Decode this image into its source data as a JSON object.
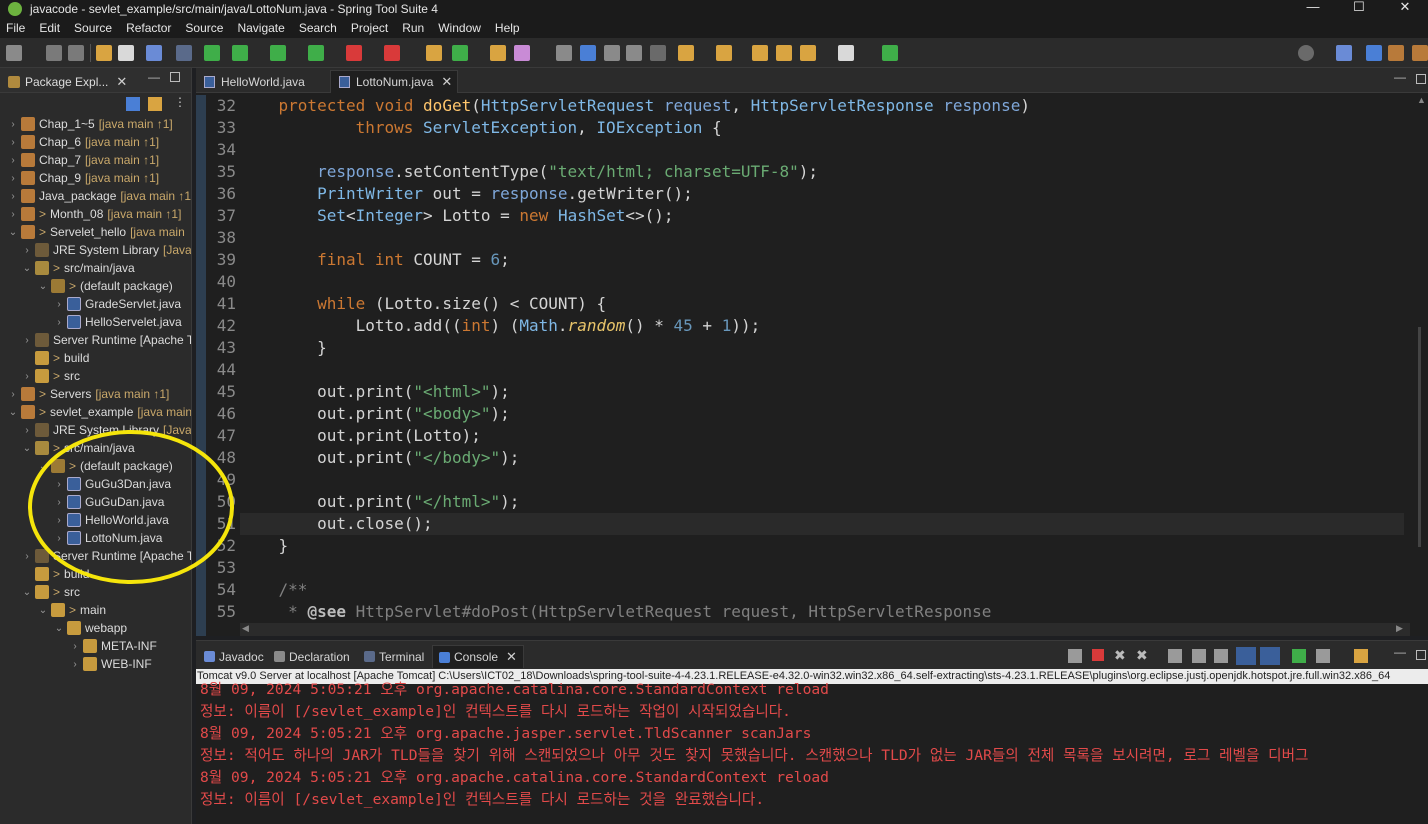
{
  "window": {
    "title": "javacode - sevlet_example/src/main/java/LottoNum.java - Spring Tool Suite 4",
    "controls": [
      "—",
      "☐",
      "✕"
    ]
  },
  "menu": [
    "File",
    "Edit",
    "Source",
    "Refactor",
    "Source",
    "Navigate",
    "Search",
    "Project",
    "Run",
    "Window",
    "Help"
  ],
  "package_explorer": {
    "tab_label": "Package Expl...",
    "tree": [
      {
        "arrow": "›",
        "icon": "project",
        "label": "Chap_1~5",
        "deco": "[java main ↑1]"
      },
      {
        "arrow": "›",
        "icon": "project",
        "label": "Chap_6",
        "deco": "[java main ↑1]"
      },
      {
        "arrow": "›",
        "icon": "project",
        "label": "Chap_7",
        "deco": "[java main ↑1]"
      },
      {
        "arrow": "›",
        "icon": "project",
        "label": "Chap_9",
        "deco": "[java main ↑1]"
      },
      {
        "arrow": "›",
        "icon": "project",
        "label": "Java_package",
        "deco": "[java main ↑1]"
      },
      {
        "arrow": "›",
        "icon": "project",
        "pre": ">",
        "label": "Month_08",
        "deco": "[java main ↑1]"
      },
      {
        "arrow": "⌄",
        "icon": "project",
        "pre": ">",
        "label": "Servelet_hello",
        "deco": "[java main"
      },
      {
        "arrow": "›",
        "icon": "jre",
        "label": "JRE System Library",
        "deco": "[JavaS"
      },
      {
        "arrow": "⌄",
        "icon": "srcfolder",
        "pre": ">",
        "label": "src/main/java",
        "deco": ""
      },
      {
        "arrow": "⌄",
        "icon": "package",
        "pre": ">",
        "label": "(default package)",
        "deco": ""
      },
      {
        "arrow": "›",
        "icon": "jfile",
        "label": "GradeServlet.java",
        "deco": ""
      },
      {
        "arrow": "›",
        "icon": "jfile",
        "label": "HelloServelet.java",
        "deco": ""
      },
      {
        "arrow": "›",
        "icon": "jre",
        "label": "Server Runtime [Apache T",
        "deco": ""
      },
      {
        "arrow": "",
        "icon": "folder",
        "pre": ">",
        "label": "build",
        "deco": ""
      },
      {
        "arrow": "›",
        "icon": "folder",
        "pre": ">",
        "label": "src",
        "deco": ""
      },
      {
        "arrow": "›",
        "icon": "project",
        "pre": ">",
        "label": "Servers",
        "deco": "[java main ↑1]"
      },
      {
        "arrow": "⌄",
        "icon": "project",
        "pre": ">",
        "label": "sevlet_example",
        "deco": "[java main"
      },
      {
        "arrow": "›",
        "icon": "jre",
        "label": "JRE System Library",
        "deco": "[JavaS"
      },
      {
        "arrow": "⌄",
        "icon": "srcfolder",
        "pre": ">",
        "label": "src/main/java",
        "deco": ""
      },
      {
        "arrow": "⌄",
        "icon": "package",
        "pre": ">",
        "label": "(default package)",
        "deco": ""
      },
      {
        "arrow": "›",
        "icon": "jfile",
        "label": "GuGu3Dan.java",
        "deco": ""
      },
      {
        "arrow": "›",
        "icon": "jfile",
        "label": "GuGuDan.java",
        "deco": ""
      },
      {
        "arrow": "›",
        "icon": "jfile",
        "label": "HelloWorld.java",
        "deco": ""
      },
      {
        "arrow": "›",
        "icon": "jfile",
        "label": "LottoNum.java",
        "deco": ""
      },
      {
        "arrow": "›",
        "icon": "jre",
        "label": "Server Runtime [Apache T",
        "deco": ""
      },
      {
        "arrow": "",
        "icon": "folder",
        "pre": ">",
        "label": "build",
        "deco": ""
      },
      {
        "arrow": "⌄",
        "icon": "folder",
        "pre": ">",
        "label": "src",
        "deco": ""
      },
      {
        "arrow": "⌄",
        "icon": "folder",
        "pre": ">",
        "label": "main",
        "deco": ""
      },
      {
        "arrow": "⌄",
        "icon": "folder",
        "label": "webapp",
        "deco": ""
      },
      {
        "arrow": "›",
        "icon": "folder",
        "label": "META-INF",
        "deco": ""
      },
      {
        "arrow": "›",
        "icon": "folder",
        "label": "WEB-INF",
        "deco": ""
      }
    ]
  },
  "editor": {
    "tabs": [
      {
        "label": "HelloWorld.java",
        "active": false
      },
      {
        "label": "LottoNum.java",
        "active": true
      }
    ],
    "line_numbers": [
      "32",
      "33",
      "34",
      "35",
      "36",
      "37",
      "38",
      "39",
      "40",
      "41",
      "42",
      "43",
      "44",
      "45",
      "46",
      "47",
      "48",
      "49",
      "50",
      "51",
      "52",
      "53",
      "54",
      "55"
    ],
    "code_lines": [
      "    protected void doGet(HttpServletRequest request, HttpServletResponse response)",
      "            throws ServletException, IOException {",
      "",
      "        response.setContentType(\"text/html; charset=UTF-8\");",
      "        PrintWriter out = response.getWriter();",
      "        Set<Integer> Lotto = new HashSet<>();",
      "",
      "        final int COUNT = 6;",
      "",
      "        while (Lotto.size() < COUNT) {",
      "            Lotto.add((int) (Math.random() * 45 + 1));",
      "        }",
      "",
      "        out.print(\"<html>\");",
      "        out.print(\"<body>\");",
      "        out.print(Lotto);",
      "        out.print(\"</body>\");",
      "",
      "        out.print(\"</html>\");",
      "        out.close();",
      "    }",
      "",
      "    /**",
      "     * @see HttpServlet#doPost(HttpServletRequest request, HttpServletResponse"
    ]
  },
  "console": {
    "tabs": [
      {
        "label": "Javadoc",
        "active": false
      },
      {
        "label": "Declaration",
        "active": false
      },
      {
        "label": "Terminal",
        "active": false
      },
      {
        "label": "Console",
        "active": true
      }
    ],
    "header": "Tomcat v9.0 Server at localhost [Apache Tomcat] C:\\Users\\ICT02_18\\Downloads\\spring-tool-suite-4-4.23.1.RELEASE-e4.32.0-win32.win32.x86_64.self-extracting\\sts-4.23.1.RELEASE\\plugins\\org.eclipse.justj.openjdk.hotspot.jre.full.win32.x86_64",
    "lines": [
      "8월 09, 2024 5:05:21 오후 org.apache.catalina.core.StandardContext reload",
      "정보: 이름이 [/sevlet_example]인 컨텍스트를 다시 로드하는 작업이 시작되었습니다.",
      "8월 09, 2024 5:05:21 오후 org.apache.jasper.servlet.TldScanner scanJars",
      "정보: 적어도 하나의 JAR가 TLD들을 찾기 위해 스캔되었으나 아무 것도 찾지 못했습니다. 스캔했으나 TLD가 없는 JAR들의 전체 목록을 보시려면, 로그 레벨을 디버그",
      "8월 09, 2024 5:05:21 오후 org.apache.catalina.core.StandardContext reload",
      "정보: 이름이 [/sevlet_example]인 컨텍스트를 다시 로드하는 것을 완료했습니다."
    ]
  },
  "colors": {
    "highlight": "#f5e50b",
    "console_text": "#e24a4a",
    "keyword": "#cc7832",
    "string": "#6aab73"
  }
}
